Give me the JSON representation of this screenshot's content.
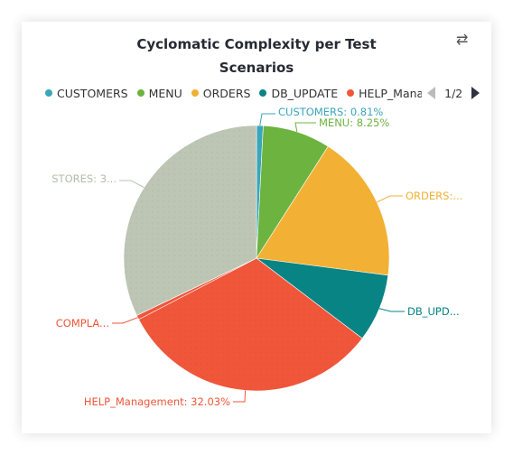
{
  "card": {
    "title_lines": [
      "Cyclomatic Complexity per Test",
      "Scenarios"
    ],
    "swap_icon": "swap-arrows-icon"
  },
  "legend": {
    "items": [
      {
        "label": "CUSTOMERS",
        "color": "#3aa6b9"
      },
      {
        "label": "MENU",
        "color": "#6db33f"
      },
      {
        "label": "ORDERS",
        "color": "#f2b134"
      },
      {
        "label": "DB_UPDATE",
        "color": "#088484"
      },
      {
        "label": "HELP_Management",
        "color": "#f0563a"
      }
    ],
    "page": "1/2",
    "prev_icon": "triangle-left-icon",
    "next_icon": "triangle-right-icon"
  },
  "chart_data": {
    "type": "pie",
    "title": "Cyclomatic Complexity per Test Scenarios",
    "legend_position": "top",
    "slices": [
      {
        "name": "CUSTOMERS",
        "percent": 0.81,
        "color": "#3aa6b9",
        "label": "CUSTOMERS: 0.81%"
      },
      {
        "name": "MENU",
        "percent": 8.25,
        "color": "#6db33f",
        "label": "MENU: 8.25%"
      },
      {
        "name": "ORDERS",
        "percent": 18.0,
        "color": "#f2b134",
        "label": "ORDERS:..."
      },
      {
        "name": "DB_UPDATE",
        "percent": 8.27,
        "color": "#088484",
        "label": "DB_UPD..."
      },
      {
        "name": "HELP_Management",
        "percent": 32.03,
        "color": "#f0563a",
        "label": "HELP_Management: 32.03%"
      },
      {
        "name": "COMPLAINTS",
        "percent": 0.54,
        "color": "#f0563a",
        "label": "COMPLA..."
      },
      {
        "name": "STORES",
        "percent": 32.1,
        "color": "#bdc5b4",
        "label": "STORES: 3..."
      }
    ]
  }
}
